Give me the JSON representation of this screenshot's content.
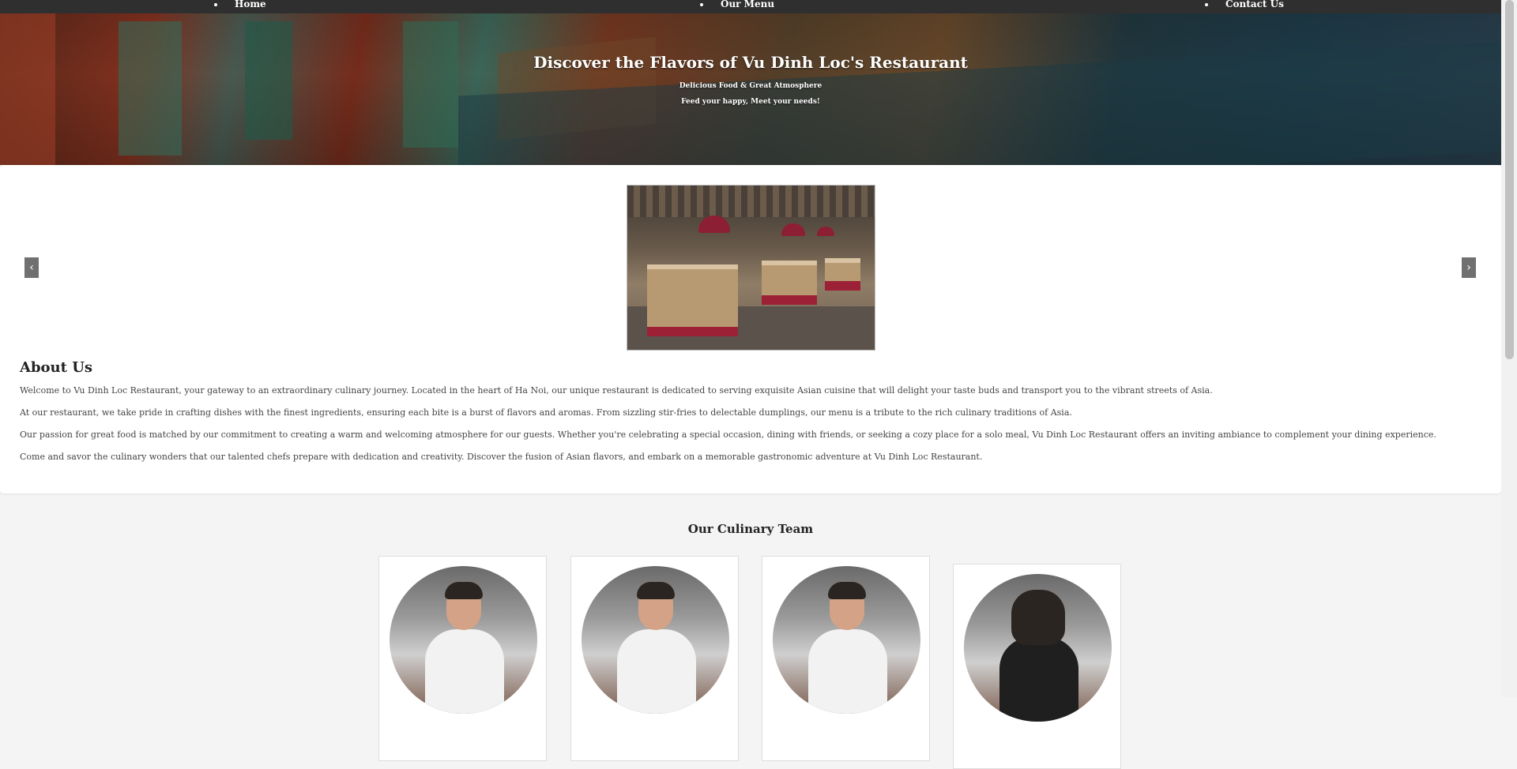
{
  "nav": {
    "items": [
      {
        "label": "Home"
      },
      {
        "label": "Our Menu"
      },
      {
        "label": "Contact Us"
      }
    ]
  },
  "hero": {
    "title": "Discover the Flavors of Vu Dinh Loc's Restaurant",
    "subtitle": "Delicious Food & Great Atmosphere",
    "tagline": "Feed your happy, Meet your needs!"
  },
  "carousel": {
    "prev_glyph": "‹",
    "next_glyph": "›"
  },
  "about": {
    "heading": "About Us",
    "paragraphs": [
      "Welcome to Vu Dinh Loc Restaurant, your gateway to an extraordinary culinary journey. Located in the heart of Ha Noi, our unique restaurant is dedicated to serving exquisite Asian cuisine that will delight your taste buds and transport you to the vibrant streets of Asia.",
      "At our restaurant, we take pride in crafting dishes with the finest ingredients, ensuring each bite is a burst of flavors and aromas. From sizzling stir-fries to delectable dumplings, our menu is a tribute to the rich culinary traditions of Asia.",
      "Our passion for great food is matched by our commitment to creating a warm and welcoming atmosphere for our guests. Whether you're celebrating a special occasion, dining with friends, or seeking a cozy place for a solo meal, Vu Dinh Loc Restaurant offers an inviting ambiance to complement your dining experience.",
      "Come and savor the culinary wonders that our talented chefs prepare with dedication and creativity. Discover the fusion of Asian flavors, and embark on a memorable gastronomic adventure at Vu Dinh Loc Restaurant."
    ]
  },
  "team": {
    "heading": "Our Culinary Team"
  },
  "colors": {
    "nav_bg": "#2f2f2f",
    "accent_red": "#8c1f33",
    "page_bg": "#f4f4f4"
  }
}
